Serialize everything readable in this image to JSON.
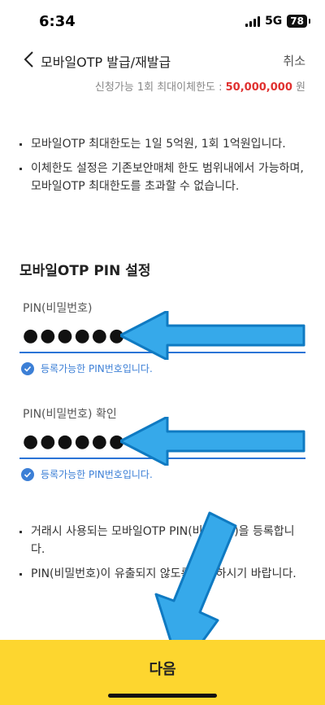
{
  "status_bar": {
    "time": "6:34",
    "network": "5G",
    "battery": "78"
  },
  "header": {
    "title": "모바일OTP 발급/재발급",
    "cancel_label": "취소"
  },
  "limit": {
    "label": "신청가능 1회 최대이체한도 :",
    "amount": "50,000,000",
    "unit": "원"
  },
  "notices_top": [
    "모바일OTP 최대한도는 1일 5억원, 1회 1억원입니다.",
    "이체한도 설정은 기존보안매체 한도 범위내에서 가능하며, 모바일OTP 최대한도를 초과할 수 없습니다."
  ],
  "pin_section": {
    "title": "모바일OTP PIN 설정",
    "pin_label": "PIN(비밀번호)",
    "pin_value": "●●●●●●",
    "pin_status": "등록가능한 PIN번호입니다.",
    "confirm_label": "PIN(비밀번호) 확인",
    "confirm_value": "●●●●●●",
    "confirm_status": "등록가능한 PIN번호입니다."
  },
  "notices_bottom": [
    "거래시 사용되는 모바일OTP PIN(비밀번호)을 등록합니다.",
    "PIN(비밀번호)이 유출되지 않도록 유의하시기 바랍니다."
  ],
  "footer": {
    "next_label": "다음"
  },
  "colors": {
    "accent_yellow": "#fdd62f",
    "link_blue": "#2a74d6",
    "amount_red": "#e0302f",
    "arrow_blue": "#36a9ea"
  }
}
